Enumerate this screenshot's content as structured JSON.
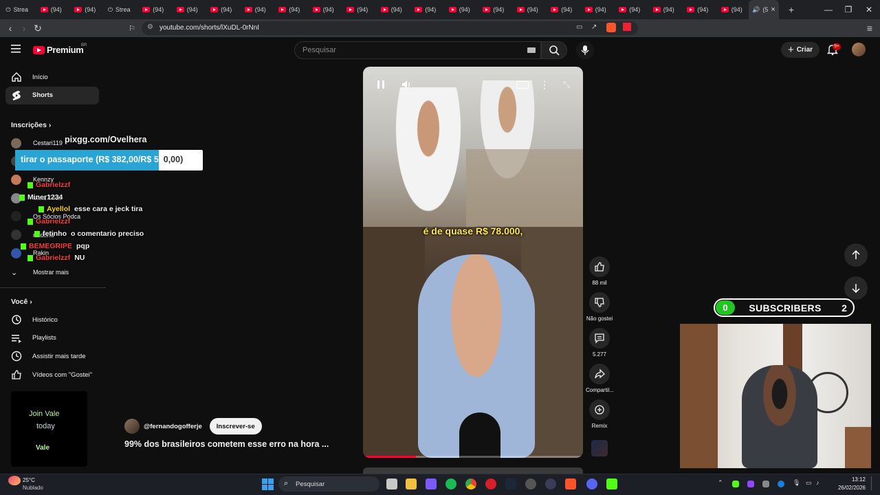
{
  "browser": {
    "tabs": [
      {
        "label": "Strea",
        "kind": "stream"
      },
      {
        "label": "(94)",
        "kind": "yt"
      },
      {
        "label": "(94)",
        "kind": "yt"
      },
      {
        "label": "Strea",
        "kind": "stream"
      },
      {
        "label": "(94)",
        "kind": "yt"
      },
      {
        "label": "(94)",
        "kind": "yt"
      },
      {
        "label": "(94)",
        "kind": "yt"
      },
      {
        "label": "(94)",
        "kind": "yt"
      },
      {
        "label": "(94)",
        "kind": "yt"
      },
      {
        "label": "(94)",
        "kind": "yt"
      },
      {
        "label": "(94)",
        "kind": "yt"
      },
      {
        "label": "(94)",
        "kind": "yt"
      },
      {
        "label": "(94)",
        "kind": "yt"
      },
      {
        "label": "(94)",
        "kind": "yt"
      },
      {
        "label": "(94)",
        "kind": "yt"
      },
      {
        "label": "(94)",
        "kind": "yt"
      },
      {
        "label": "(94)",
        "kind": "yt"
      },
      {
        "label": "(94)",
        "kind": "yt"
      },
      {
        "label": "(94)",
        "kind": "yt"
      },
      {
        "label": "(94)",
        "kind": "yt"
      },
      {
        "label": "(94)",
        "kind": "yt"
      },
      {
        "label": "(94)",
        "kind": "yt"
      }
    ],
    "active_tab_label": "(5",
    "new_tab": "+",
    "url": "youtube.com/shorts/lXuDL-0rNnI",
    "window_controls": {
      "minimize": "—",
      "maximize": "❐",
      "close": "✕"
    }
  },
  "header": {
    "logo_text": "Premium",
    "logo_sup": "BR",
    "search_placeholder": "Pesquisar",
    "create_label": "Criar",
    "notification_badge": "9+"
  },
  "sidebar": {
    "main_items": [
      {
        "label": "Início",
        "icon": "home-icon"
      },
      {
        "label": "Shorts",
        "icon": "shorts-icon",
        "active": true
      }
    ],
    "subscriptions_title": "Inscrições",
    "subscriptions": [
      {
        "label": "Cestari119",
        "color": "#7a6a5a"
      },
      {
        "label": "",
        "color": "#444"
      },
      {
        "label": "Kennzy",
        "color": "#c47a5a"
      },
      {
        "label": "Mind Trick",
        "color": "#888"
      },
      {
        "label": "Os Sócios Podca",
        "color": "#222"
      },
      {
        "label": "rtudohd",
        "color": "#333"
      },
      {
        "label": "Rakin",
        "color": "#3355aa"
      }
    ],
    "show_more": "Mostrar mais",
    "you_title": "Você",
    "you_items": [
      {
        "label": "Histórico",
        "icon": "history-icon"
      },
      {
        "label": "Playlists",
        "icon": "playlists-icon"
      },
      {
        "label": "Assistir mais tarde",
        "icon": "watch-later-icon"
      },
      {
        "label": "Vídeos com \"Gostei\"",
        "icon": "liked-icon"
      }
    ]
  },
  "overlay": {
    "pix_label": "pixgg.com/Ovelhera",
    "goal_text": "tirar o passaporte (R$ 382,00/R$ 500,00)",
    "goal_fraction": 0.764,
    "chat": [
      {
        "user": "Gabrielzzf",
        "text": "",
        "color": "#ff3b3b"
      },
      {
        "user": "Miner1234",
        "text": "",
        "color": "#f1f1f1"
      },
      {
        "user": "Ayellol",
        "text": "esse cara e jeck tira",
        "color": "#ffd400"
      },
      {
        "user": "Gabrielzzf",
        "text": "",
        "color": "#ff3b3b"
      },
      {
        "user": "fetinho",
        "text": "o comentario preciso",
        "color": "#f1f1f1"
      },
      {
        "user": "BEMEGRIPE",
        "text": "pqp",
        "color": "#ff3b3b"
      },
      {
        "user": "Gabrielzzf",
        "text": "NU",
        "color": "#ff3b3b"
      }
    ],
    "join_line1": "Join",
    "join_brand": "Vale",
    "join_line2": "today",
    "join_logo": "Vale"
  },
  "short": {
    "caption": "é de quase R$ 78.000,",
    "progress": 0.24
  },
  "actions": [
    {
      "label": "88 mil",
      "icon": "like-icon"
    },
    {
      "label": "Não gostei",
      "icon": "dislike-icon"
    },
    {
      "label": "5.277",
      "icon": "comment-icon"
    },
    {
      "label": "Compartil...",
      "icon": "share-icon"
    },
    {
      "label": "Remix",
      "icon": "remix-icon"
    }
  ],
  "channel": {
    "handle": "@fernandogofferje",
    "subscribe_label": "Inscrever-se"
  },
  "video_title": "99% dos brasileiros cometem esse erro na hora ...",
  "subscriber_widget": {
    "left_count": "0",
    "label": "SUBSCRIBERS",
    "right_count": "2"
  },
  "taskbar": {
    "weather_temp": "25°C",
    "weather_desc": "Nublado",
    "search_label": "Pesquisar",
    "time": "13:12",
    "date": "26/02/2026"
  },
  "colors": {
    "youtube_red": "#ff0033",
    "kick_green": "#53fc18",
    "goal_blue": "#2aa4d4",
    "subs_green": "#22c522"
  }
}
